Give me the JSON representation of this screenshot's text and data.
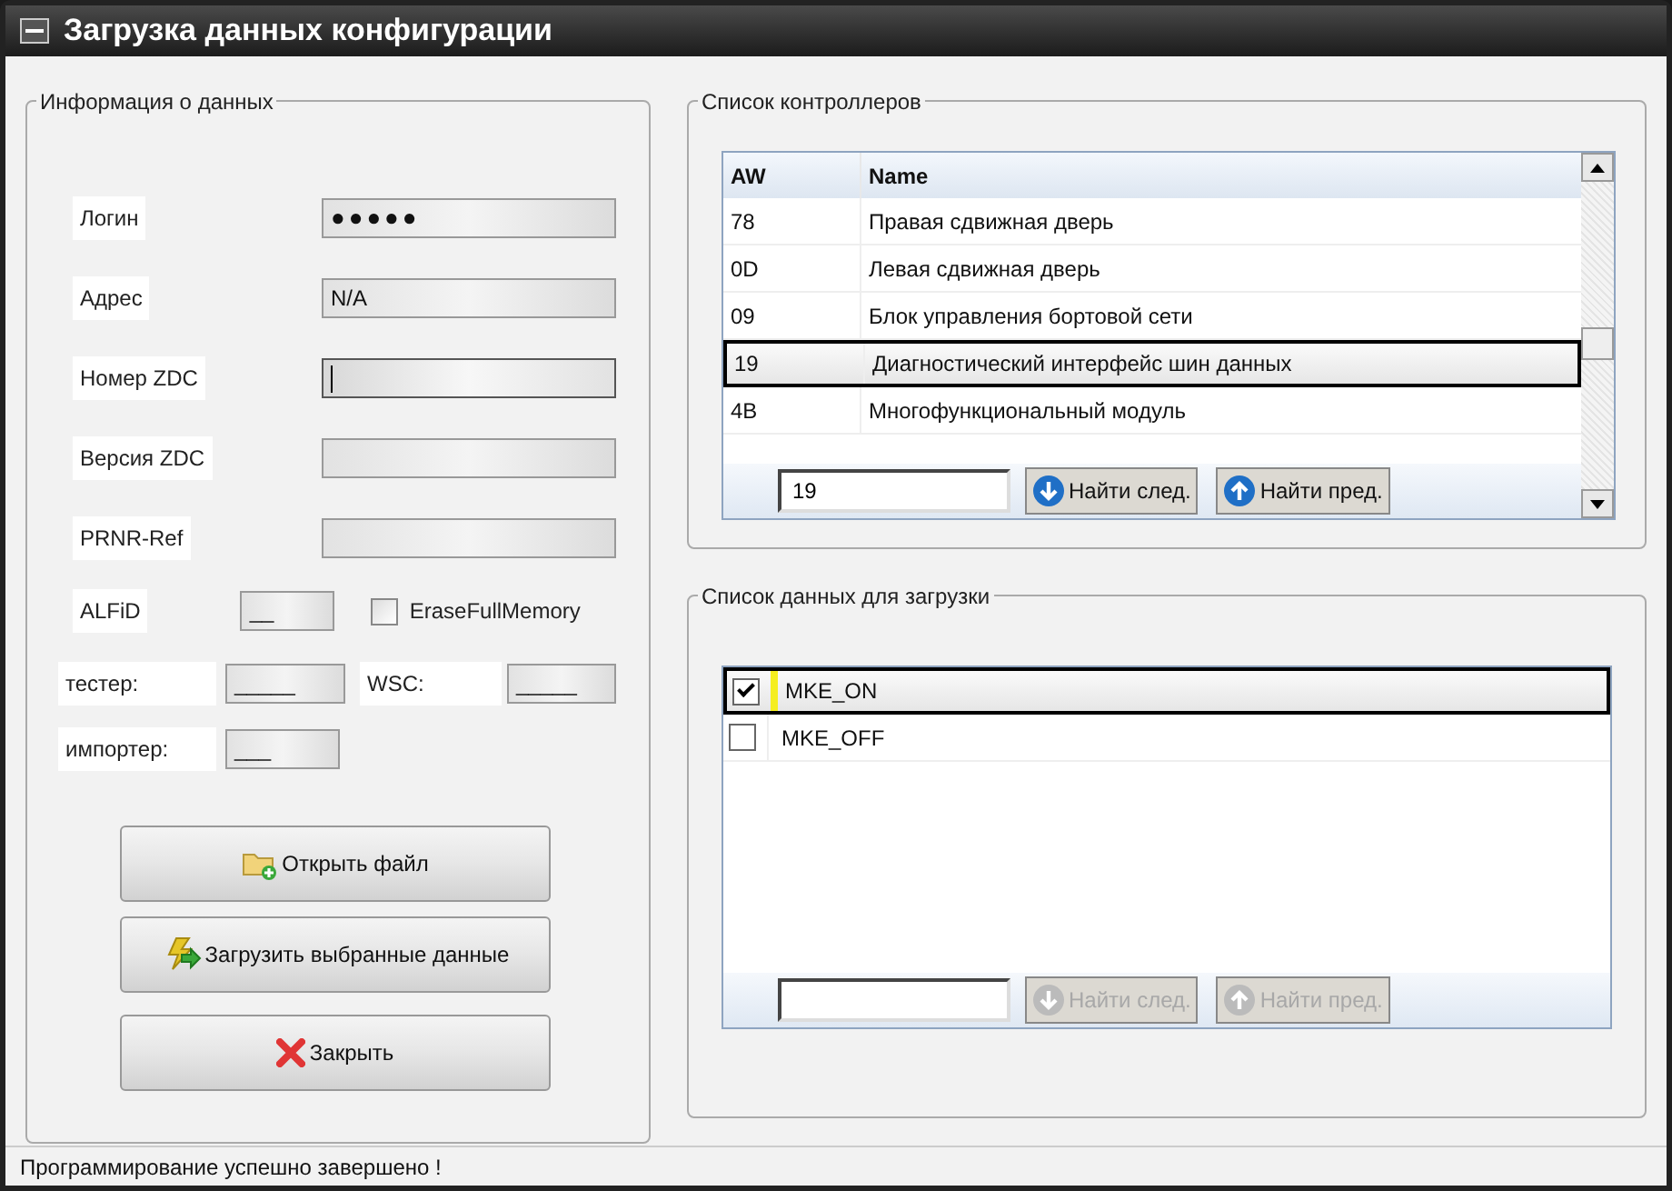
{
  "window": {
    "title": "Загрузка данных конфигурации"
  },
  "data_info": {
    "title": "Информация о данных",
    "fields": [
      {
        "label": "Логин",
        "value": "●●●●●",
        "focused": false
      },
      {
        "label": "Адрес",
        "value": "N/A",
        "focused": false
      },
      {
        "label": "Номер ZDC",
        "focused": true
      },
      {
        "label": "Версия ZDC",
        "focused": false
      },
      {
        "label": "PRNR-Ref",
        "focused": false
      }
    ],
    "alfid": {
      "label": "ALFiD",
      "value": "__"
    },
    "erase_full_memory": {
      "label": "EraseFullMemory",
      "checked": false
    },
    "tester": {
      "label": "тестер:",
      "value": "_____"
    },
    "wsc": {
      "label": "WSC:",
      "value": "_____"
    },
    "importer": {
      "label": "импортер:",
      "value": "___"
    },
    "buttons": [
      {
        "label": "Открыть файл"
      },
      {
        "label": "Загрузить выбранные данные"
      },
      {
        "label": "Закрыть"
      }
    ]
  },
  "controllers": {
    "title": "Список контроллеров",
    "columns": [
      "AW",
      "Name"
    ],
    "rows": [
      {
        "aw": "78",
        "name": "Правая сдвижная дверь",
        "selected": false
      },
      {
        "aw": "0D",
        "name": "Левая сдвижная дверь",
        "selected": false
      },
      {
        "aw": "09",
        "name": "Блок управления бортовой сети",
        "selected": false
      },
      {
        "aw": "19",
        "name": "Диагностический интерфейс шин данных",
        "selected": true
      },
      {
        "aw": "4B",
        "name": "Многофункциональный модуль",
        "selected": false
      }
    ],
    "search": {
      "value": "19"
    },
    "buttons": [
      {
        "label": "Найти след.",
        "disabled": false
      },
      {
        "label": "Найти пред.",
        "disabled": false
      }
    ]
  },
  "load_list": {
    "title": "Список данных для загрузки",
    "items": [
      {
        "label": "MKE_ON",
        "checked": true,
        "selected": true
      },
      {
        "label": "MKE_OFF",
        "checked": false,
        "selected": false
      }
    ],
    "buttons": [
      {
        "label": "Найти след.",
        "disabled": true
      },
      {
        "label": "Найти пред.",
        "disabled": true
      }
    ]
  },
  "status_bar": {
    "text": "Программирование успешно завершено !"
  }
}
